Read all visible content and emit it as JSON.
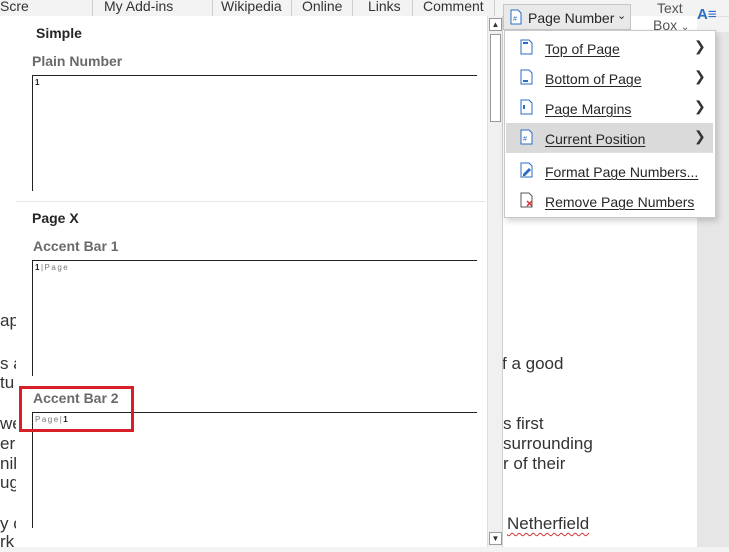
{
  "ribbon": {
    "screenshot_partial": "Scre",
    "addins_partial": "My Add-ins",
    "wikipedia": "Wikipedia",
    "online": "Online",
    "links": "Links",
    "comment": "Comment",
    "page_number_button": "Page Number",
    "text_box_line1": "Text",
    "text_box_line2": "Box",
    "t_fragment": "t"
  },
  "gallery": {
    "section_simple": "Simple",
    "plain_number": "Plain Number",
    "plain_number_preview": "1",
    "section_page_x": "Page X",
    "accent_bar_1": "Accent Bar 1",
    "accent_bar_1_number": "1",
    "accent_bar_1_sep": "|",
    "accent_bar_1_word": "Page",
    "accent_bar_2": "Accent Bar 2",
    "accent_bar_2_word": "Page",
    "accent_bar_2_sep": "|",
    "accent_bar_2_number": "1"
  },
  "menu": {
    "items": [
      {
        "label": "Top of Page",
        "has_submenu": true
      },
      {
        "label": "Bottom of Page",
        "has_submenu": true
      },
      {
        "label": "Page Margins",
        "has_submenu": true
      },
      {
        "label": "Current Position",
        "has_submenu": true,
        "active": true
      },
      {
        "label": "Format Page Numbers...",
        "has_submenu": false
      },
      {
        "label": "Remove Page Numbers",
        "has_submenu": false
      }
    ]
  },
  "document": {
    "frag_ap": "ap",
    "frag_s_a": "s a",
    "frag_tu": "tu",
    "frag_we": "we",
    "frag_er": "er",
    "frag_nil": "nil",
    "frag_ug": "ug",
    "frag_y_c": "y c",
    "frag_rk": "rk i",
    "frag_of_a_good": "f a good",
    "frag_first": "s first",
    "frag_surrounding": "surrounding",
    "frag_of_their": "r of their",
    "frag_netherfield": "Netherfield"
  },
  "colors": {
    "highlight": "#d61f27",
    "active_item": "#dadada",
    "accent_blue": "#2b6cc4"
  }
}
